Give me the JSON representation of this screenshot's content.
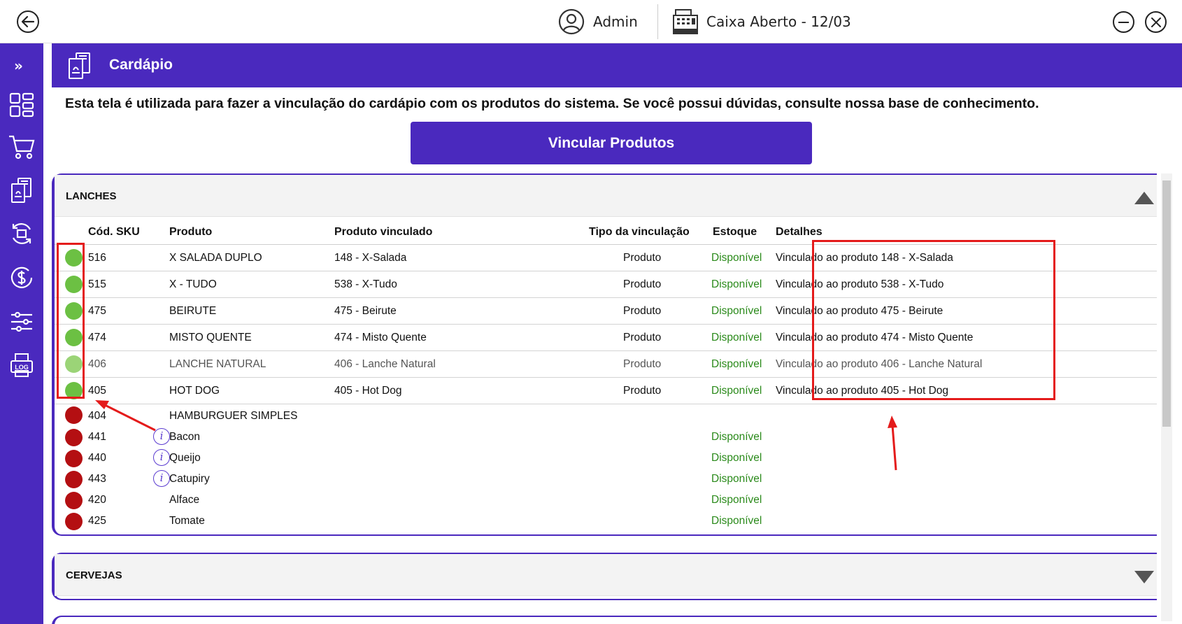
{
  "topbar": {
    "user_name": "Admin",
    "cash_status": "Caixa Aberto - 12/03"
  },
  "sidebar": {
    "expand_label": "»",
    "items": [
      {
        "icon": "dashboard-icon"
      },
      {
        "icon": "cart-icon"
      },
      {
        "icon": "menu-icon"
      },
      {
        "icon": "sync-icon"
      },
      {
        "icon": "money-icon"
      },
      {
        "icon": "settings-icon"
      },
      {
        "icon": "log-icon",
        "label": "LOG"
      }
    ]
  },
  "header": {
    "title": "Cardápio"
  },
  "intro_text": "Esta tela é utilizada para fazer a vinculação do cardápio com os produtos do sistema. Se você possui dúvidas, consulte nossa base de conhecimento.",
  "link_button": "Vincular Produtos",
  "table": {
    "columns": {
      "sku": "Cód. SKU",
      "product": "Produto",
      "linked": "Produto vinculado",
      "type": "Tipo da vinculação",
      "stock": "Estoque",
      "details": "Detalhes"
    }
  },
  "sections": [
    {
      "title": "LANCHES",
      "expanded": true,
      "rows": [
        {
          "status": "green",
          "sku": "516",
          "product": "X SALADA DUPLO",
          "linked": "148 - X-Salada",
          "type": "Produto",
          "stock": "Disponível",
          "details": "Vinculado ao produto 148 - X-Salada"
        },
        {
          "status": "green",
          "sku": "515",
          "product": "X - TUDO",
          "linked": "538 - X-Tudo",
          "type": "Produto",
          "stock": "Disponível",
          "details": "Vinculado ao produto 538 - X-Tudo"
        },
        {
          "status": "green",
          "sku": "475",
          "product": "BEIRUTE",
          "linked": "475 - Beirute",
          "type": "Produto",
          "stock": "Disponível",
          "details": "Vinculado ao produto 475 - Beirute"
        },
        {
          "status": "green",
          "sku": "474",
          "product": "MISTO QUENTE",
          "linked": "474 - Misto Quente",
          "type": "Produto",
          "stock": "Disponível",
          "details": "Vinculado ao produto 474 - Misto Quente"
        },
        {
          "status": "lightgreen",
          "sku": "406",
          "product": "LANCHE NATURAL",
          "linked": "406 - Lanche Natural",
          "type": "Produto",
          "stock": "Disponível",
          "details": "Vinculado ao produto 406 - Lanche Natural"
        },
        {
          "status": "green",
          "sku": "405",
          "product": "HOT DOG",
          "linked": "405 - Hot Dog",
          "type": "Produto",
          "stock": "Disponível",
          "details": "Vinculado ao produto 405 - Hot Dog"
        },
        {
          "status": "red",
          "sku": "404",
          "product": "HAMBURGUER SIMPLES"
        },
        {
          "status": "red",
          "sku": "441",
          "info": true,
          "product": "Bacon",
          "stock": "Disponível"
        },
        {
          "status": "red",
          "sku": "440",
          "info": true,
          "product": "Queijo",
          "stock": "Disponível"
        },
        {
          "status": "red",
          "sku": "443",
          "info": true,
          "product": "Catupiry",
          "stock": "Disponível"
        },
        {
          "status": "red",
          "sku": "420",
          "product": "Alface",
          "stock": "Disponível"
        },
        {
          "status": "red",
          "sku": "425",
          "product": "Tomate",
          "stock": "Disponível"
        }
      ]
    },
    {
      "title": "CERVEJAS",
      "expanded": false
    }
  ],
  "colors": {
    "brand": "#4a29be",
    "status_green": "#6cc043",
    "status_red": "#b40f12",
    "stock_text": "#2a8a1a",
    "annotation": "#e41b1b"
  }
}
